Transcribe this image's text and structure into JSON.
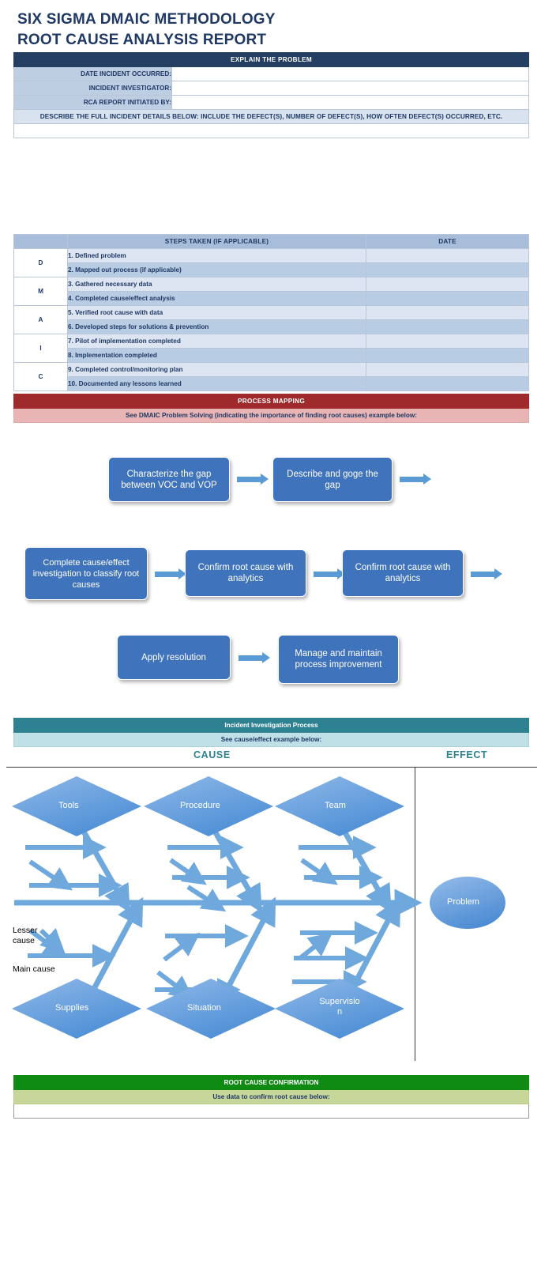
{
  "title": {
    "line1": "SIX SIGMA DMAIC METHODOLOGY",
    "line2": "ROOT CAUSE ANALYSIS REPORT"
  },
  "explain": {
    "header": "EXPLAIN THE PROBLEM",
    "fields": [
      {
        "label": "DATE INCIDENT OCCURRED:",
        "value": ""
      },
      {
        "label": "INCIDENT INVESTIGATOR:",
        "value": ""
      },
      {
        "label": "RCA REPORT INITIATED BY:",
        "value": ""
      }
    ],
    "describe_header": "DESCRIBE THE FULL INCIDENT DETAILS BELOW: INCLUDE THE DEFECT(S), NUMBER OF DEFECT(S), HOW OFTEN DEFECT(S) OCCURRED, ETC.",
    "describe_value": ""
  },
  "steps": {
    "col_steps": "STEPS TAKEN (IF APPLICABLE)",
    "col_date": "DATE",
    "dmaic": [
      "D",
      "M",
      "A",
      "I",
      "C"
    ],
    "rows": [
      {
        "text": "1. Defined problem",
        "date": ""
      },
      {
        "text": "2. Mapped out process (if applicable)",
        "date": ""
      },
      {
        "text": "3. Gathered necessary data",
        "date": ""
      },
      {
        "text": "4. Completed cause/effect analysis",
        "date": ""
      },
      {
        "text": "5. Verified root cause with data",
        "date": ""
      },
      {
        "text": "6. Developed steps for solutions & prevention",
        "date": ""
      },
      {
        "text": "7. Pilot of implementation completed",
        "date": ""
      },
      {
        "text": "8. Implementation completed",
        "date": ""
      },
      {
        "text": "9. Completed control/monitoring plan",
        "date": ""
      },
      {
        "text": "10. Documented any lessons learned",
        "date": ""
      }
    ]
  },
  "process_mapping": {
    "header": "PROCESS MAPPING",
    "subheader": "See DMAIC Problem Solving (indicating the importance of finding root causes) example below:",
    "boxes": [
      "Characterize the gap between VOC and VOP",
      "Describe and goge the gap",
      "Complete cause/effect investigation to classify root causes",
      "Confirm root cause with analytics",
      "Confirm root cause with analytics",
      "Apply resolution",
      "Manage and maintain process improvement"
    ]
  },
  "incident_investigation": {
    "header": "Incident Investigation Process",
    "subheader": "See cause/effect example below:",
    "cause_label": "CAUSE",
    "effect_label": "EFFECT"
  },
  "fishbone": {
    "categories_top": [
      "Tools",
      "Procedure",
      "Team"
    ],
    "categories_bottom": [
      "Supplies",
      "Situation",
      "Supervisio\nn"
    ],
    "effect": "Problem",
    "annotations": [
      "Lesser\ncause",
      "Main cause"
    ]
  },
  "root_cause_confirmation": {
    "header": "ROOT CAUSE CONFIRMATION",
    "subheader": "Use data to confirm root cause below:",
    "value": ""
  },
  "colors": {
    "navy": "#243f61",
    "title_navy": "#1f3864",
    "label_blue": "#bdcee3",
    "band_light": "#d9e3f0",
    "steps_head": "#a8bdd9",
    "row_light": "#dce5f1",
    "row_dark": "#b8cce4",
    "maroon": "#9e2a2b",
    "maroon_light": "#e8b4b4",
    "flow_blue": "#3f73bb",
    "arrow_blue": "#5b9bd5",
    "teal": "#2e8190",
    "teal_light": "#bfe0e6",
    "green": "#0f8a13",
    "green_light": "#c7d79a"
  }
}
